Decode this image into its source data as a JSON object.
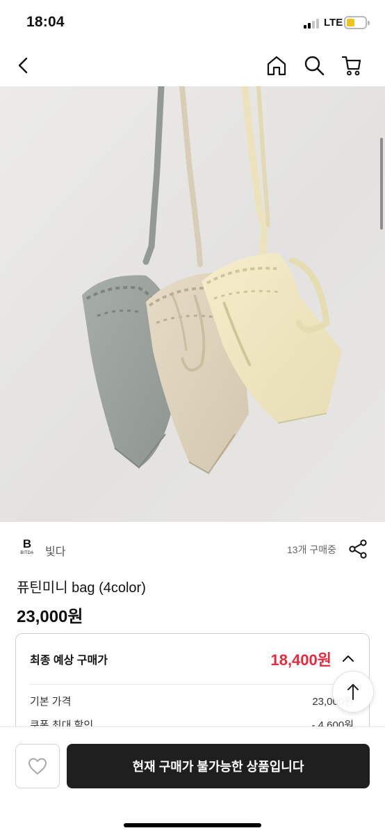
{
  "status_bar": {
    "time": "18:04",
    "network": "LTE",
    "battery_color": "#f0c419"
  },
  "nav": {
    "icons": [
      "back-icon",
      "home-icon",
      "search-icon",
      "cart-icon"
    ]
  },
  "product_image": {
    "description_icon": "product-photo",
    "bag_colors": [
      "#9da39e",
      "#ddd3bd",
      "#f0e7c3"
    ]
  },
  "brand": {
    "logo_letter": "B",
    "logo_small_text": "BITDA",
    "name": "빛다",
    "buyers_text": "13개 구매중"
  },
  "product": {
    "title": "퓨틴미니 bag (4color)",
    "price": "23,000원"
  },
  "price_card": {
    "final_label": "최종 예상 구매가",
    "final_price": "18,400원",
    "final_price_color": "#e8283d",
    "rows": [
      {
        "label": "기본 가격",
        "value": "23,000원"
      },
      {
        "label": "쿠폰 최대 할인",
        "value": "- 4,600원"
      }
    ]
  },
  "bottom_bar": {
    "buy_button_label": "현재 구매가 불가능한 상품입니다",
    "buy_button_color": "#1f1f1f"
  }
}
